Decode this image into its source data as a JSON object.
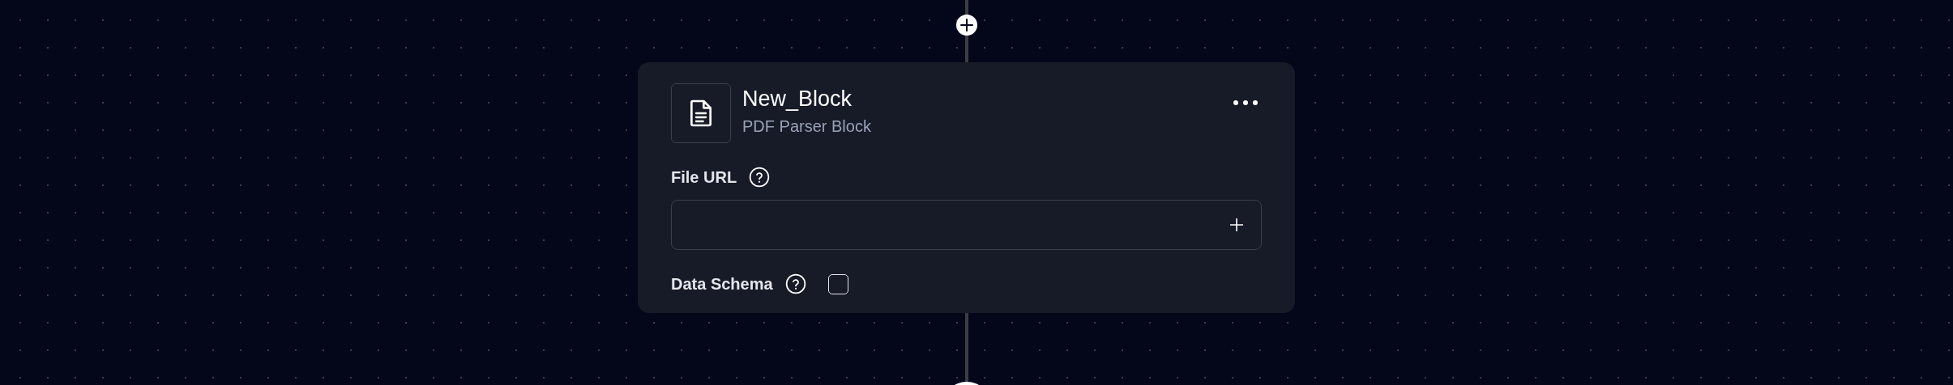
{
  "block": {
    "title": "New_Block",
    "subtitle": "PDF Parser Block"
  },
  "fields": [
    {
      "kind": "file",
      "label": "File URL"
    },
    {
      "kind": "checkbox",
      "label": "Data Schema",
      "checked": false
    }
  ]
}
